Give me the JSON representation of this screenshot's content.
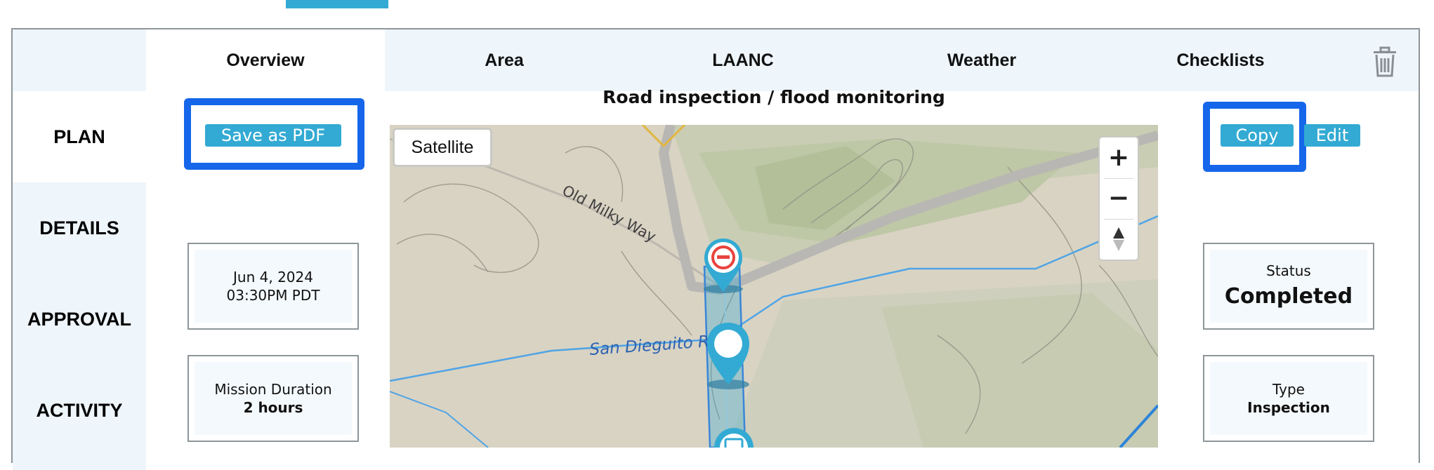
{
  "tabs": [
    {
      "label": "Overview",
      "active": true
    },
    {
      "label": "Area"
    },
    {
      "label": "LAANC"
    },
    {
      "label": "Weather"
    },
    {
      "label": "Checklists"
    }
  ],
  "trash_icon": "trash-icon",
  "sidebar": {
    "items": [
      {
        "label": "PLAN",
        "active": true
      },
      {
        "label": "DETAILS"
      },
      {
        "label": "APPROVAL"
      },
      {
        "label": "ACTIVITY"
      }
    ]
  },
  "actions": {
    "save_pdf": "Save as PDF",
    "copy": "Copy",
    "edit": "Edit"
  },
  "plan": {
    "title": "Road inspection / flood monitoring",
    "date": "Jun 4, 2024",
    "time": "03:30PM PDT",
    "duration_label": "Mission Duration",
    "duration_value": "2 hours",
    "status_label": "Status",
    "status_value": "Completed",
    "type_label": "Type",
    "type_value": "Inspection"
  },
  "map": {
    "satellite_label": "Satellite",
    "zoom_in": "+",
    "zoom_out": "−",
    "road_label": "Old Milky Way",
    "river_label": "San Dieguito River",
    "markers": [
      "no-entry-marker-icon",
      "location-pin-icon",
      "camera-marker-icon"
    ],
    "compass_icon": "compass-north-icon"
  },
  "colors": {
    "accent": "#33aad3",
    "highlight": "#1566ea",
    "tab_bg": "#eef5fb",
    "marker_red": "#e8433f"
  }
}
